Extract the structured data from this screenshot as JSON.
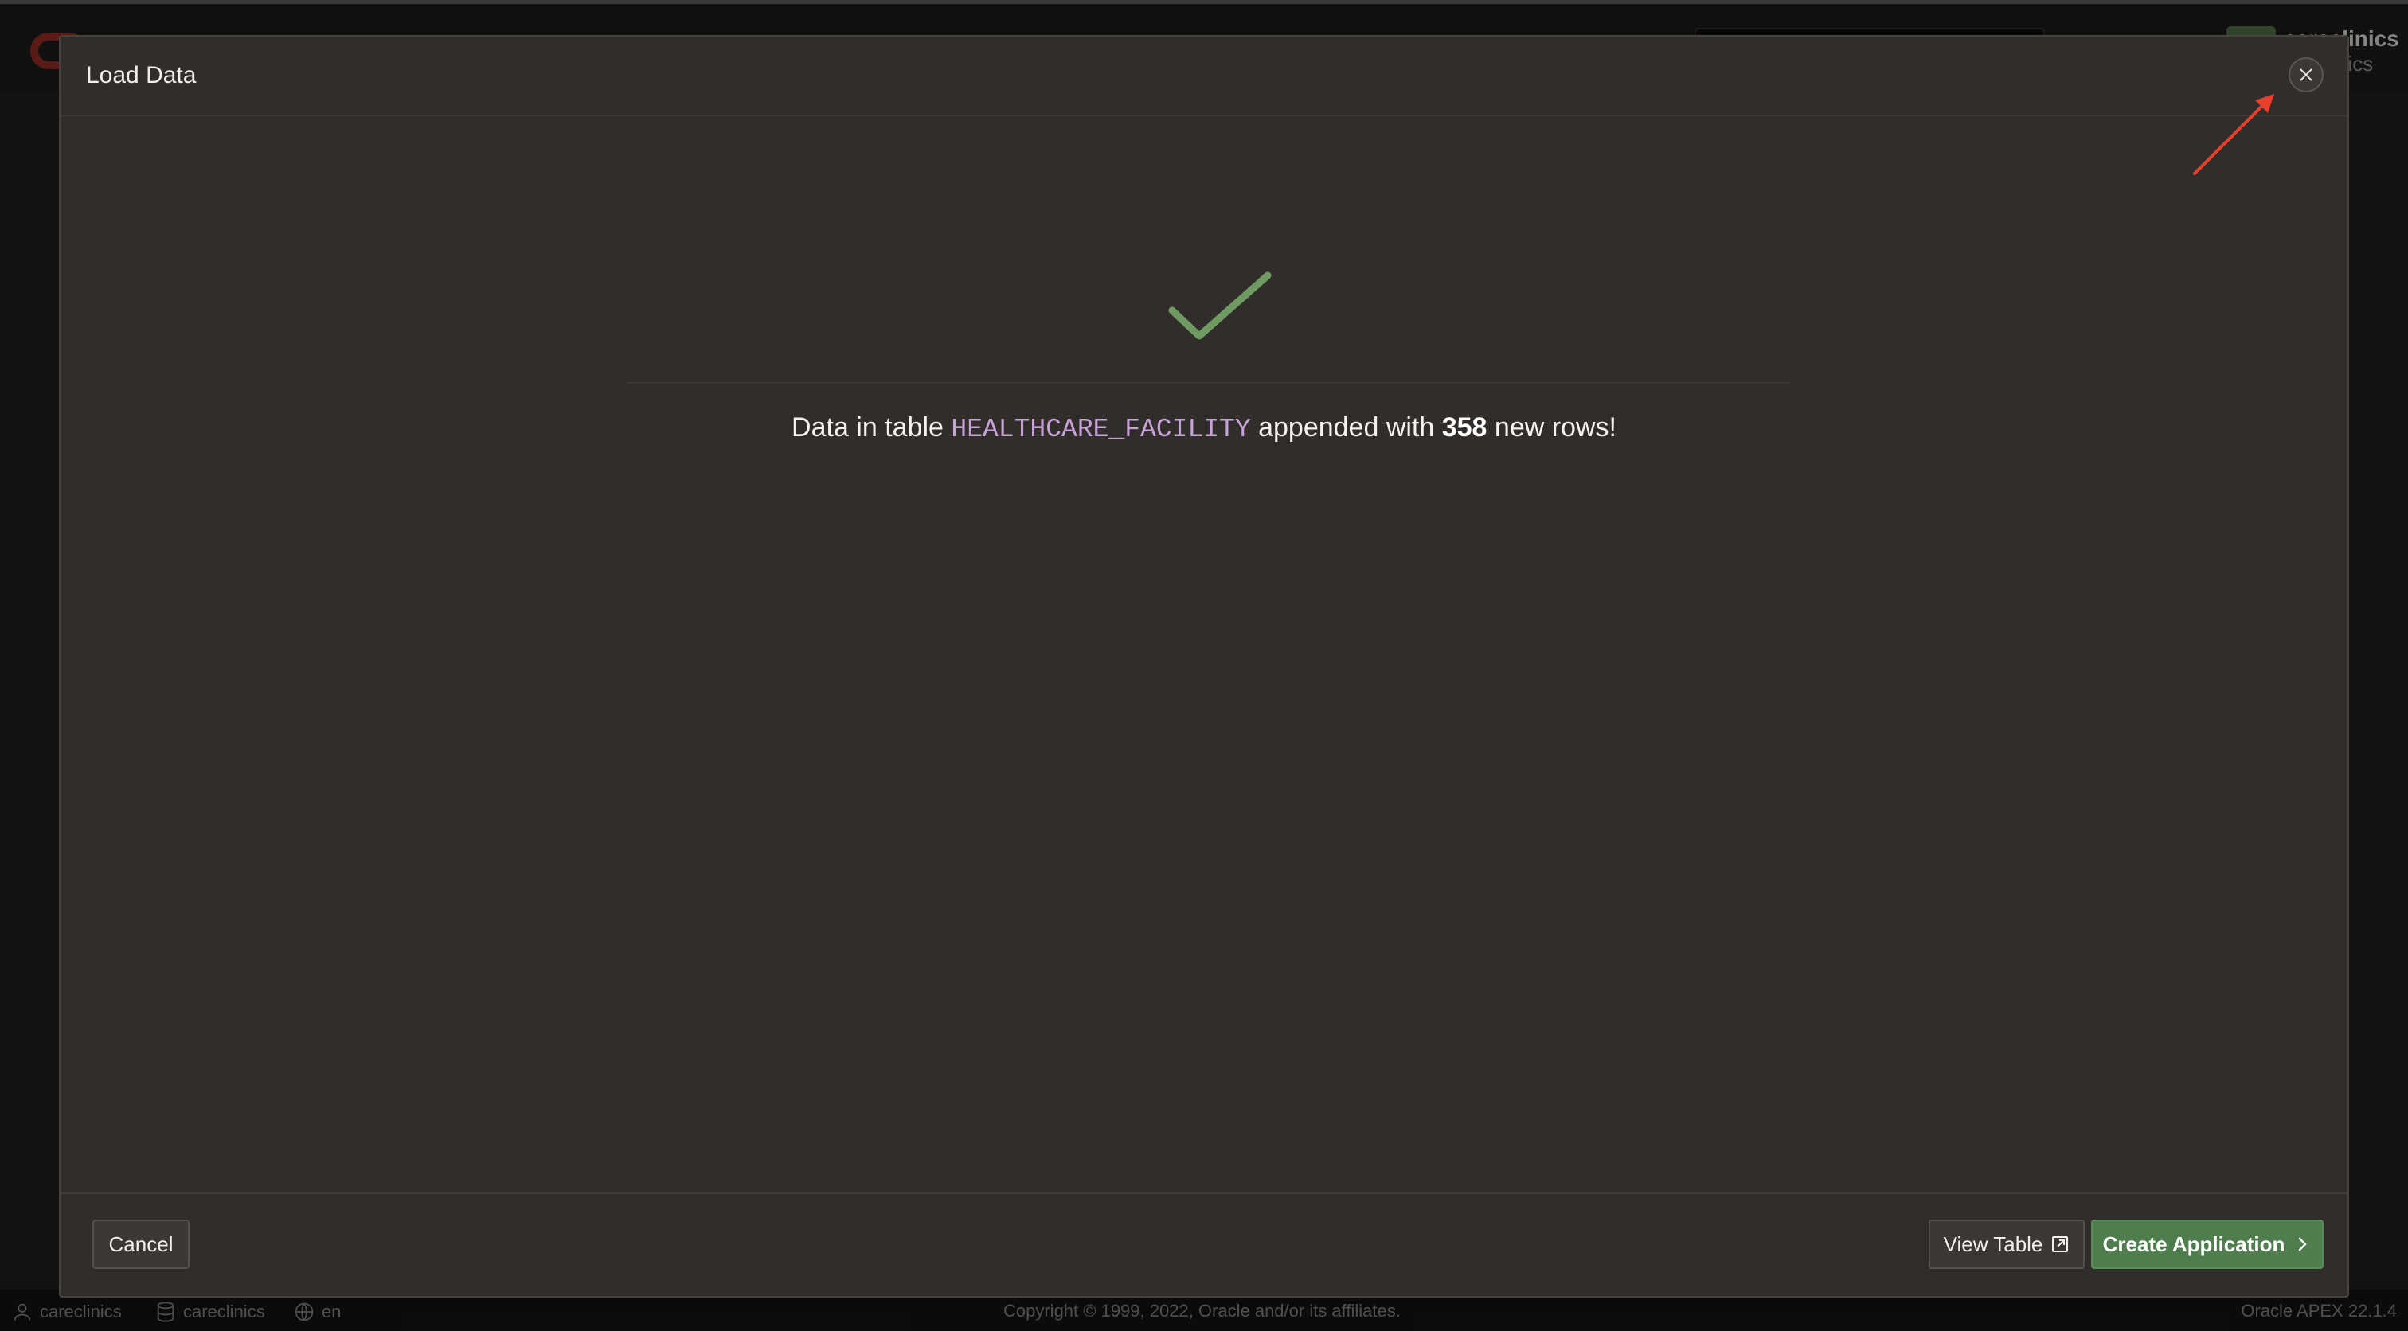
{
  "background": {
    "user_name": "careclinics",
    "user_sub": "nics"
  },
  "footer": {
    "user": "careclinics",
    "workspace": "careclinics",
    "language": "en",
    "copyright": "Copyright © 1999, 2022, Oracle and/or its affiliates.",
    "version": "Oracle APEX 22.1.4"
  },
  "dialog": {
    "title": "Load Data",
    "message_prefix": "Data in table ",
    "table_name": "HEALTHCARE_FACILITY",
    "message_middle": " appended with ",
    "row_count": "358",
    "message_suffix": " new rows!",
    "buttons": {
      "cancel": "Cancel",
      "view_table": "View Table",
      "create_application": "Create Application"
    }
  },
  "colors": {
    "accent_green": "#4f7d4d",
    "check_green": "#6f9a62",
    "table_name_purple": "#c9a2d8",
    "annotation_red": "#e8402d"
  },
  "icons": {
    "close": "close-icon",
    "check": "check-icon",
    "external": "external-link-icon",
    "next": "chevron-right-icon"
  }
}
